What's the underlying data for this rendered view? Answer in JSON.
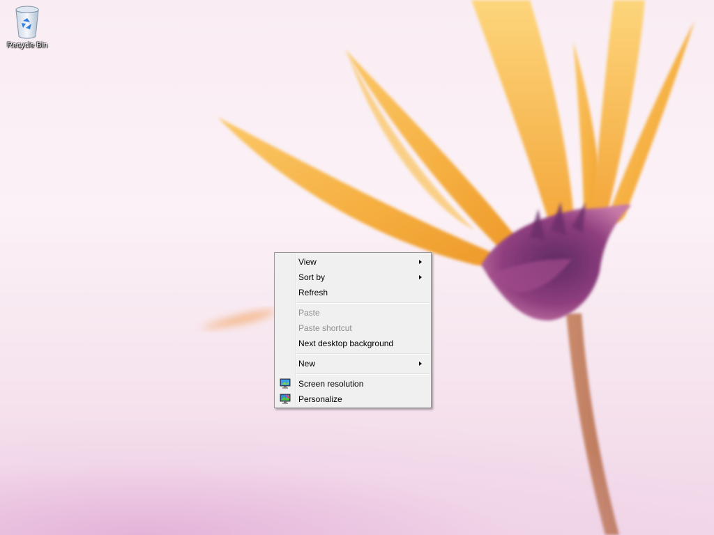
{
  "desktop": {
    "icons": [
      {
        "label": "Recycle Bin",
        "icon": "recycle-bin-icon"
      }
    ]
  },
  "context_menu": {
    "items": [
      {
        "label": "View",
        "submenu": true,
        "enabled": true
      },
      {
        "label": "Sort by",
        "submenu": true,
        "enabled": true
      },
      {
        "label": "Refresh",
        "submenu": false,
        "enabled": true
      },
      {
        "label": "Paste",
        "submenu": false,
        "enabled": false
      },
      {
        "label": "Paste shortcut",
        "submenu": false,
        "enabled": false
      },
      {
        "label": "Next desktop background",
        "submenu": false,
        "enabled": true
      },
      {
        "label": "New",
        "submenu": true,
        "enabled": true
      },
      {
        "label": "Screen resolution",
        "submenu": false,
        "enabled": true,
        "icon": "screen-resolution-icon"
      },
      {
        "label": "Personalize",
        "submenu": false,
        "enabled": true,
        "icon": "personalize-icon"
      }
    ]
  },
  "colors": {
    "menu_background": "#f0f0f0",
    "menu_border": "#979797",
    "disabled_text": "#8d8d8d",
    "wallpaper_petal": "#f7b64a",
    "wallpaper_flower_center": "#8a3b7a"
  }
}
